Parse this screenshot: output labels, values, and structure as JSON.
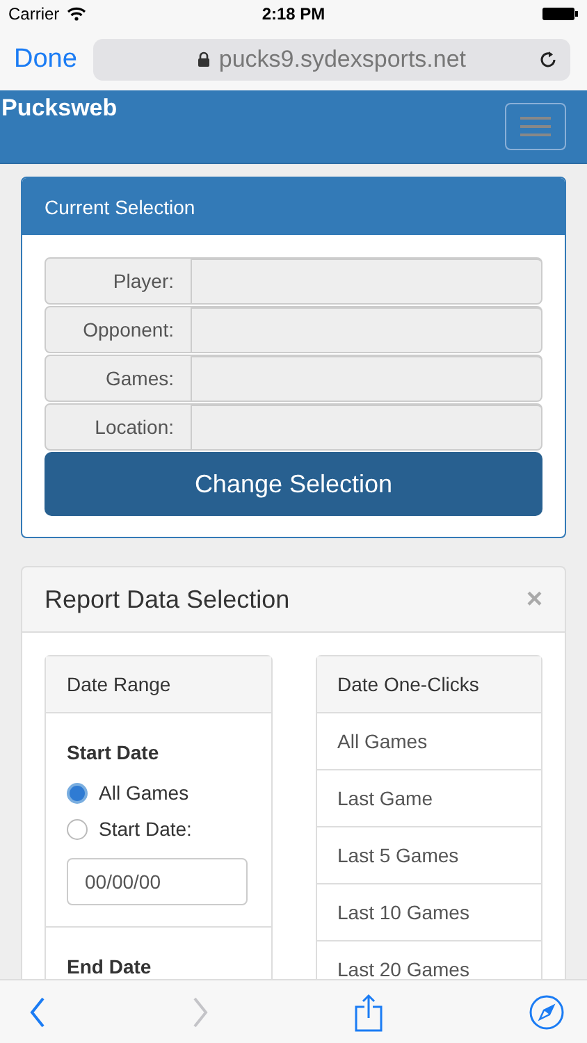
{
  "status_bar": {
    "carrier": "Carrier",
    "time": "2:18 PM"
  },
  "browser": {
    "done": "Done",
    "url": "pucks9.sydexsports.net"
  },
  "navbar": {
    "brand": "Pucksweb"
  },
  "current_selection": {
    "title": "Current Selection",
    "fields": [
      {
        "label": "Player:"
      },
      {
        "label": "Opponent:"
      },
      {
        "label": "Games:"
      },
      {
        "label": "Location:"
      }
    ],
    "button": "Change Selection"
  },
  "report": {
    "title": "Report Data Selection",
    "close": "×",
    "date_range": {
      "title": "Date Range",
      "start_heading": "Start Date",
      "options": [
        {
          "label": "All Games",
          "selected": true
        },
        {
          "label": "Start Date:",
          "selected": false
        }
      ],
      "date_placeholder": "00/00/00",
      "end_heading": "End Date"
    },
    "one_clicks": {
      "title": "Date One-Clicks",
      "items": [
        "All Games",
        "Last Game",
        "Last 5 Games",
        "Last 10 Games",
        "Last 20 Games"
      ]
    }
  },
  "toolbar": {
    "back_disabled": false,
    "forward_disabled": true
  }
}
